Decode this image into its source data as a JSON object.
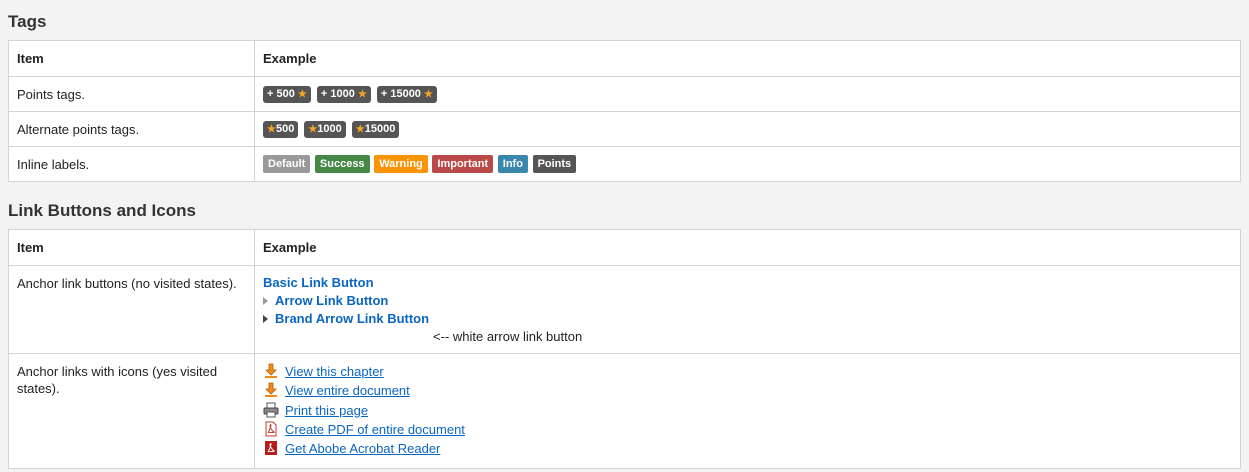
{
  "sections": {
    "tags_title": "Tags",
    "links_title": "Link Buttons and Icons"
  },
  "tags_table": {
    "col_item": "Item",
    "col_example": "Example",
    "points_row_label": "Points tags.",
    "points_tags": [
      "+ 500",
      "+ 1000",
      "+ 15000"
    ],
    "alt_row_label": "Alternate points tags.",
    "alt_tags": [
      "500",
      "1000",
      "15000"
    ],
    "inline_row_label": "Inline labels.",
    "inline_labels": [
      "Default",
      "Success",
      "Warning",
      "Important",
      "Info",
      "Points"
    ]
  },
  "links_table": {
    "col_item": "Item",
    "col_example": "Example",
    "anchor_row_label": "Anchor link buttons (no visited states).",
    "basic_link": "Basic Link Button",
    "arrow_link": "Arrow Link Button",
    "brand_arrow_link": "Brand Arrow Link Button",
    "white_arrow_note": "<-- white arrow link button",
    "icon_row_label": "Anchor links with icons (yes visited states).",
    "icon_links": [
      "View this chapter",
      "View entire document",
      "Print this page",
      "Create PDF of entire document",
      "Get Abobe Acrobat Reader"
    ]
  },
  "colors": {
    "tag_bg": "#555555",
    "star": "#f5a623",
    "default": "#999999",
    "success": "#468847",
    "warning": "#f89406",
    "important": "#b94a48",
    "info": "#3a87ad",
    "points": "#555555",
    "link": "#0a66c2"
  },
  "icons": [
    "download-arrow-icon",
    "download-arrow-icon",
    "printer-icon",
    "pdf-icon",
    "pdf-icon"
  ]
}
